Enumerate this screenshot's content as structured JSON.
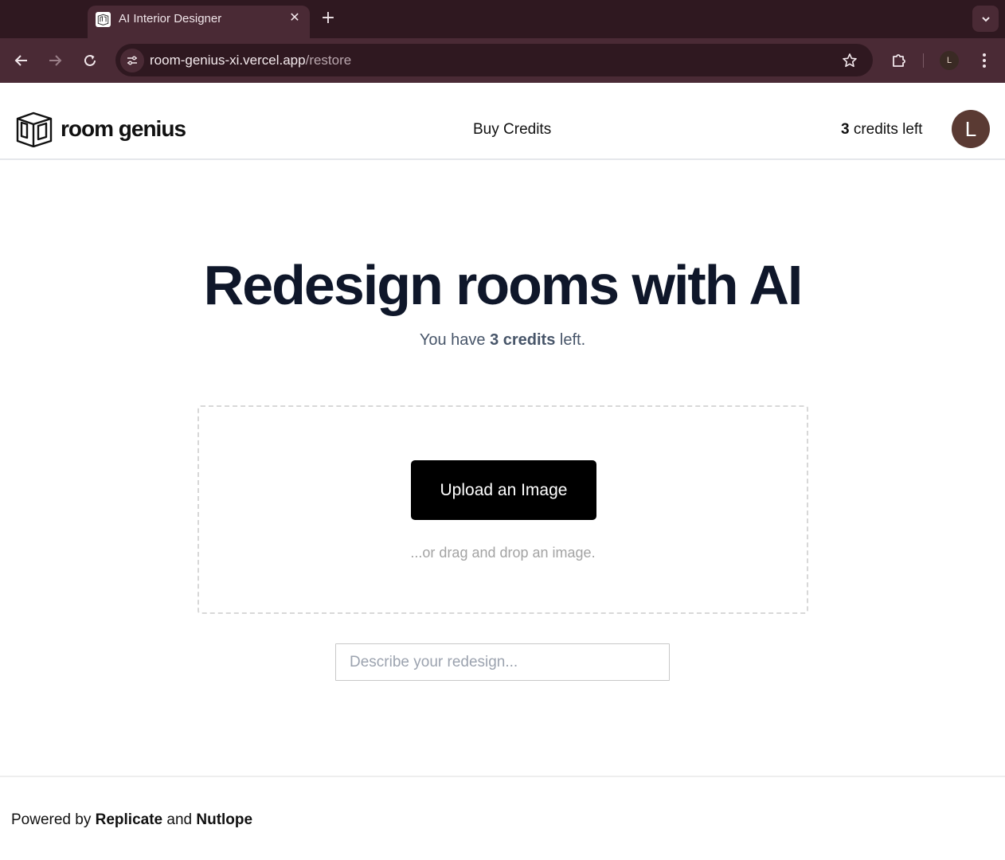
{
  "browser": {
    "tab_title": "AI Interior Designer",
    "url_host": "room-genius-xi.vercel.app",
    "url_path": "/restore",
    "profile_initial": "L"
  },
  "header": {
    "logo_text": "room genius",
    "buy_credits": "Buy Credits",
    "credits_count": "3",
    "credits_suffix": " credits left",
    "avatar_initial": "L"
  },
  "main": {
    "title": "Redesign rooms with AI",
    "subtitle_prefix": "You have ",
    "subtitle_credits": "3 credits",
    "subtitle_suffix": " left.",
    "upload_label": "Upload an Image",
    "drag_hint": "...or drag and drop an image.",
    "describe_placeholder": "Describe your redesign..."
  },
  "footer": {
    "prefix": "Powered by ",
    "replicate": "Replicate",
    "and": " and ",
    "nutlope": "Nutlope"
  },
  "colors": {
    "chrome_dark": "#2f1820",
    "chrome_light": "#4a2a35",
    "title_color": "#0f172a",
    "avatar_bg": "#5a3a33",
    "button_bg": "#000000"
  }
}
